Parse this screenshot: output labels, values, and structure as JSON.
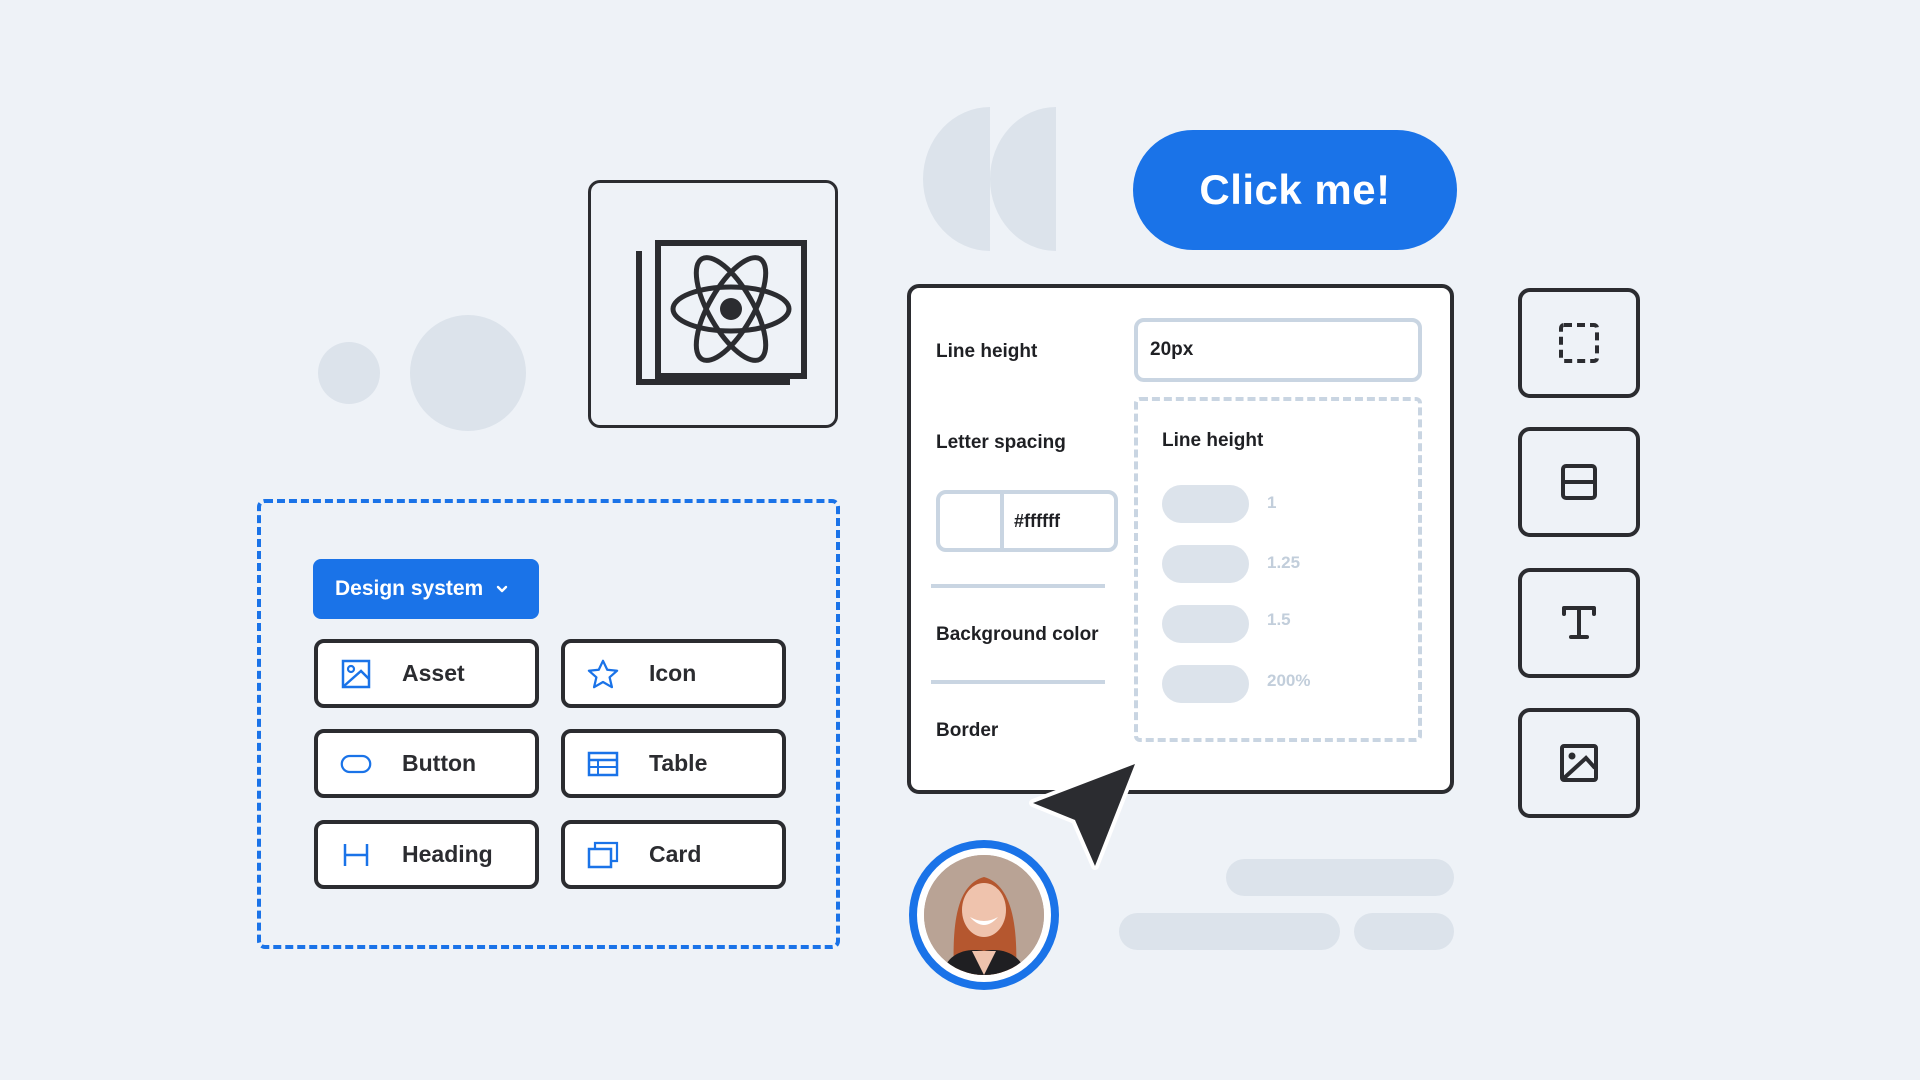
{
  "design_system": {
    "dropdown_label": "Design system",
    "components": [
      {
        "label": "Asset",
        "icon": "image-icon"
      },
      {
        "label": "Icon",
        "icon": "star-icon"
      },
      {
        "label": "Button",
        "icon": "button-shape-icon"
      },
      {
        "label": "Table",
        "icon": "table-icon"
      },
      {
        "label": "Heading",
        "icon": "heading-icon"
      },
      {
        "label": "Card",
        "icon": "card-stack-icon"
      }
    ]
  },
  "cta": {
    "label": "Click me!"
  },
  "properties": {
    "line_height_label": "Line height",
    "line_height_value": "20px",
    "letter_spacing_label": "Letter spacing",
    "color_hex": "#ffffff",
    "background_color_label": "Background color",
    "border_label": "Border",
    "line_height_menu": {
      "title": "Line height",
      "options": [
        "1",
        "1.25",
        "1.5",
        "200%"
      ]
    }
  },
  "toolbar": {
    "tools": [
      {
        "name": "select-frame",
        "icon": "dashed-square-icon"
      },
      {
        "name": "layout",
        "icon": "split-layout-icon"
      },
      {
        "name": "text",
        "icon": "text-icon"
      },
      {
        "name": "image",
        "icon": "image-icon"
      }
    ]
  },
  "colors": {
    "accent": "#1a73e8",
    "outline": "#2b2c30",
    "muted": "#dce3eb",
    "field_border": "#c9d5e2",
    "background": "#eef2f7"
  }
}
